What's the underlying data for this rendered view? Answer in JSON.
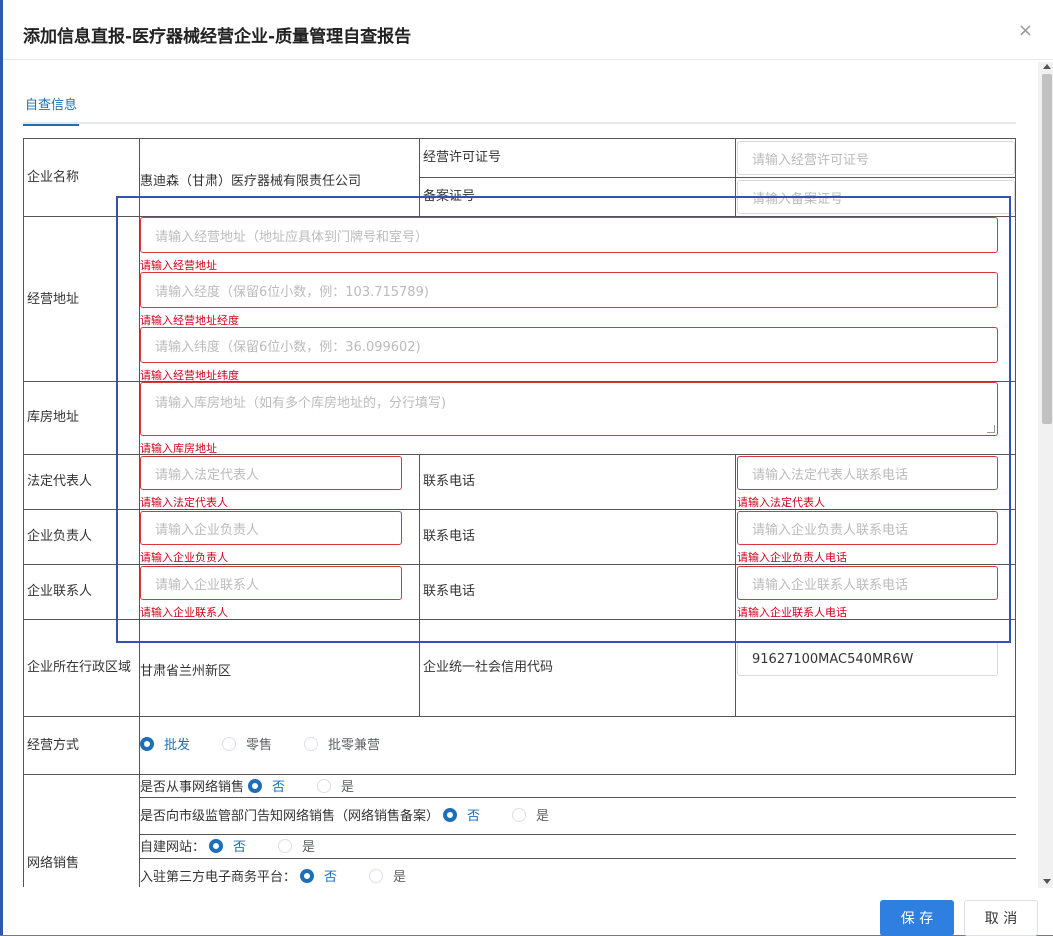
{
  "dialog": {
    "title": "添加信息直报-医疗器械经营企业-质量管理自查报告",
    "close_glyph": "×",
    "tab": "自查信息"
  },
  "form": {
    "company_name": {
      "label": "企业名称",
      "value": "惠迪森（甘肃）医疗器械有限责任公司"
    },
    "license_no": {
      "label": "经营许可证号",
      "placeholder": "请输入经营许可证号"
    },
    "record_no": {
      "label": "备案证号",
      "placeholder": "请输入备案证号"
    },
    "business_address": {
      "label": "经营地址",
      "address": {
        "placeholder": "请输入经营地址（地址应具体到门牌号和室号）",
        "error": "请输入经营地址"
      },
      "longitude": {
        "placeholder": "请输入经度（保留6位小数，例：103.715789)",
        "error": "请输入经营地址经度"
      },
      "latitude": {
        "placeholder": "请输入纬度（保留6位小数，例：36.099602)",
        "error": "请输入经营地址纬度"
      }
    },
    "warehouse_address": {
      "label": "库房地址",
      "placeholder": "请输入库房地址（如有多个库房地址的，分行填写)",
      "error": "请输入库房地址"
    },
    "legal_rep": {
      "label": "法定代表人",
      "placeholder": "请输入法定代表人",
      "error": "请输入法定代表人",
      "phone_label": "联系电话",
      "phone_placeholder": "请输入法定代表人联系电话",
      "phone_error": "请输入法定代表人"
    },
    "principal": {
      "label": "企业负责人",
      "placeholder": "请输入企业负责人",
      "error": "请输入企业负责人",
      "phone_label": "联系电话",
      "phone_placeholder": "请输入企业负责人联系电话",
      "phone_error": "请输入企业负责人电话"
    },
    "contact": {
      "label": "企业联系人",
      "placeholder": "请输入企业联系人",
      "error": "请输入企业联系人",
      "phone_label": "联系电话",
      "phone_placeholder": "请输入企业联系人联系电话",
      "phone_error": "请输入企业联系人电话"
    },
    "region": {
      "label": "企业所在行政区域",
      "value": "甘肃省兰州新区"
    },
    "credit_code": {
      "label": "企业统一社会信用代码",
      "value": "91627100MAC540MR6W"
    },
    "business_mode": {
      "label": "经营方式",
      "options": [
        "批发",
        "零售",
        "批零兼营"
      ],
      "selected": "批发"
    },
    "online_sales": {
      "label": "网络销售",
      "q1": {
        "question": "是否从事网络销售",
        "options": [
          "否",
          "是"
        ],
        "selected": "否"
      },
      "q2": {
        "question": "是否向市级监管部门告知网络销售（网络销售备案）",
        "options": [
          "否",
          "是"
        ],
        "selected": "否"
      },
      "q3": {
        "question": "自建网站：",
        "options": [
          "否",
          "是"
        ],
        "selected": "否"
      },
      "q4": {
        "question": "入驻第三方电子商务平台：",
        "options": [
          "否",
          "是"
        ],
        "selected": "否"
      }
    }
  },
  "footer": {
    "save": "保 存",
    "cancel": "取 消"
  },
  "colors": {
    "primary": "#2f7fe0",
    "error": "#d9363e",
    "highlight": "#3153b6",
    "tab": "#1d6fb8"
  }
}
